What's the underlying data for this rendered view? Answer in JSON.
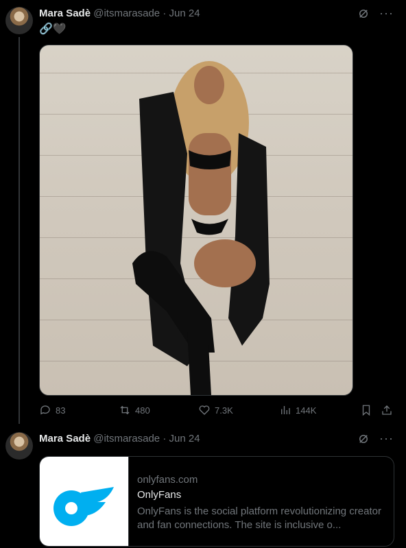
{
  "tweet1": {
    "author_name": "Mara Sadè",
    "handle": "@itsmarasade",
    "separator": "·",
    "date": "Jun 24",
    "text": "🔗🖤",
    "stats": {
      "replies": "83",
      "reposts": "480",
      "likes": "7.3K",
      "views": "144K"
    }
  },
  "tweet2": {
    "author_name": "Mara Sadè",
    "handle": "@itsmarasade",
    "separator": "·",
    "date": "Jun 24",
    "card": {
      "domain": "onlyfans.com",
      "title": "OnlyFans",
      "description": "OnlyFans is the social platform revolutionizing creator and fan connections. The site is inclusive o..."
    }
  },
  "colors": {
    "bg": "#000000",
    "text": "#e7e9ea",
    "muted": "#71767b",
    "border": "#2f3336",
    "brand_blue": "#00aff0"
  }
}
